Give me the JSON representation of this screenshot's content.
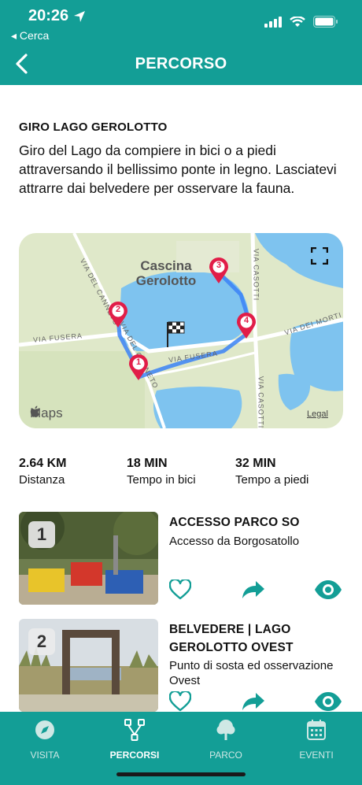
{
  "status": {
    "time": "20:26",
    "back_label": "◂ Cerca"
  },
  "nav": {
    "title": "PERCORSO"
  },
  "route": {
    "title": "GIRO LAGO GEROLOTTO",
    "description": "Giro del Lago da compiere in bici o a piedi attraversando il bellissimo ponte in legno. Lasciatevi attrarre dai belvedere per osservare la fauna."
  },
  "map": {
    "place_label_1": "Cascina",
    "place_label_2": "Gerolotto",
    "roads": {
      "via_fusera_left": "VIA FUSERA",
      "via_fusera_right": "VIA FUSERA",
      "via_del_canneto": "VIA DEL CANNETO",
      "via_del_canneto_2": "VIA DEL CANNETO",
      "via_casotti_top": "VIA CASOTTI",
      "via_casotti_bottom": "VIA CASOTTI",
      "via_dei_morti": "VIA DEI MORTI"
    },
    "markers": [
      "1",
      "2",
      "3",
      "4"
    ],
    "brand": "Maps",
    "legal": "Legal",
    "water_color": "#7ec3ef",
    "land_color": "#dfe8c9",
    "route_color": "#3b82f6",
    "marker_color": "#e11d48"
  },
  "stats": [
    {
      "value": "2.64 KM",
      "label": "Distanza"
    },
    {
      "value": "18 MIN",
      "label": "Tempo in bici"
    },
    {
      "value": "32 MIN",
      "label": "Tempo a piedi"
    }
  ],
  "pois": [
    {
      "number": "1",
      "title": "ACCESSO PARCO SO",
      "subtitle": "Accesso da Borgosatollo"
    },
    {
      "number": "2",
      "title": "BELVEDERE | LAGO GEROLOTTO OVEST",
      "subtitle": "Punto di sosta ed osservazione Ovest"
    }
  ],
  "tabs": [
    {
      "label": "VISITA",
      "icon": "compass-icon"
    },
    {
      "label": "PERCORSI",
      "icon": "route-icon"
    },
    {
      "label": "PARCO",
      "icon": "tree-icon"
    },
    {
      "label": "EVENTI",
      "icon": "calendar-icon"
    }
  ],
  "colors": {
    "accent": "#139e96"
  }
}
